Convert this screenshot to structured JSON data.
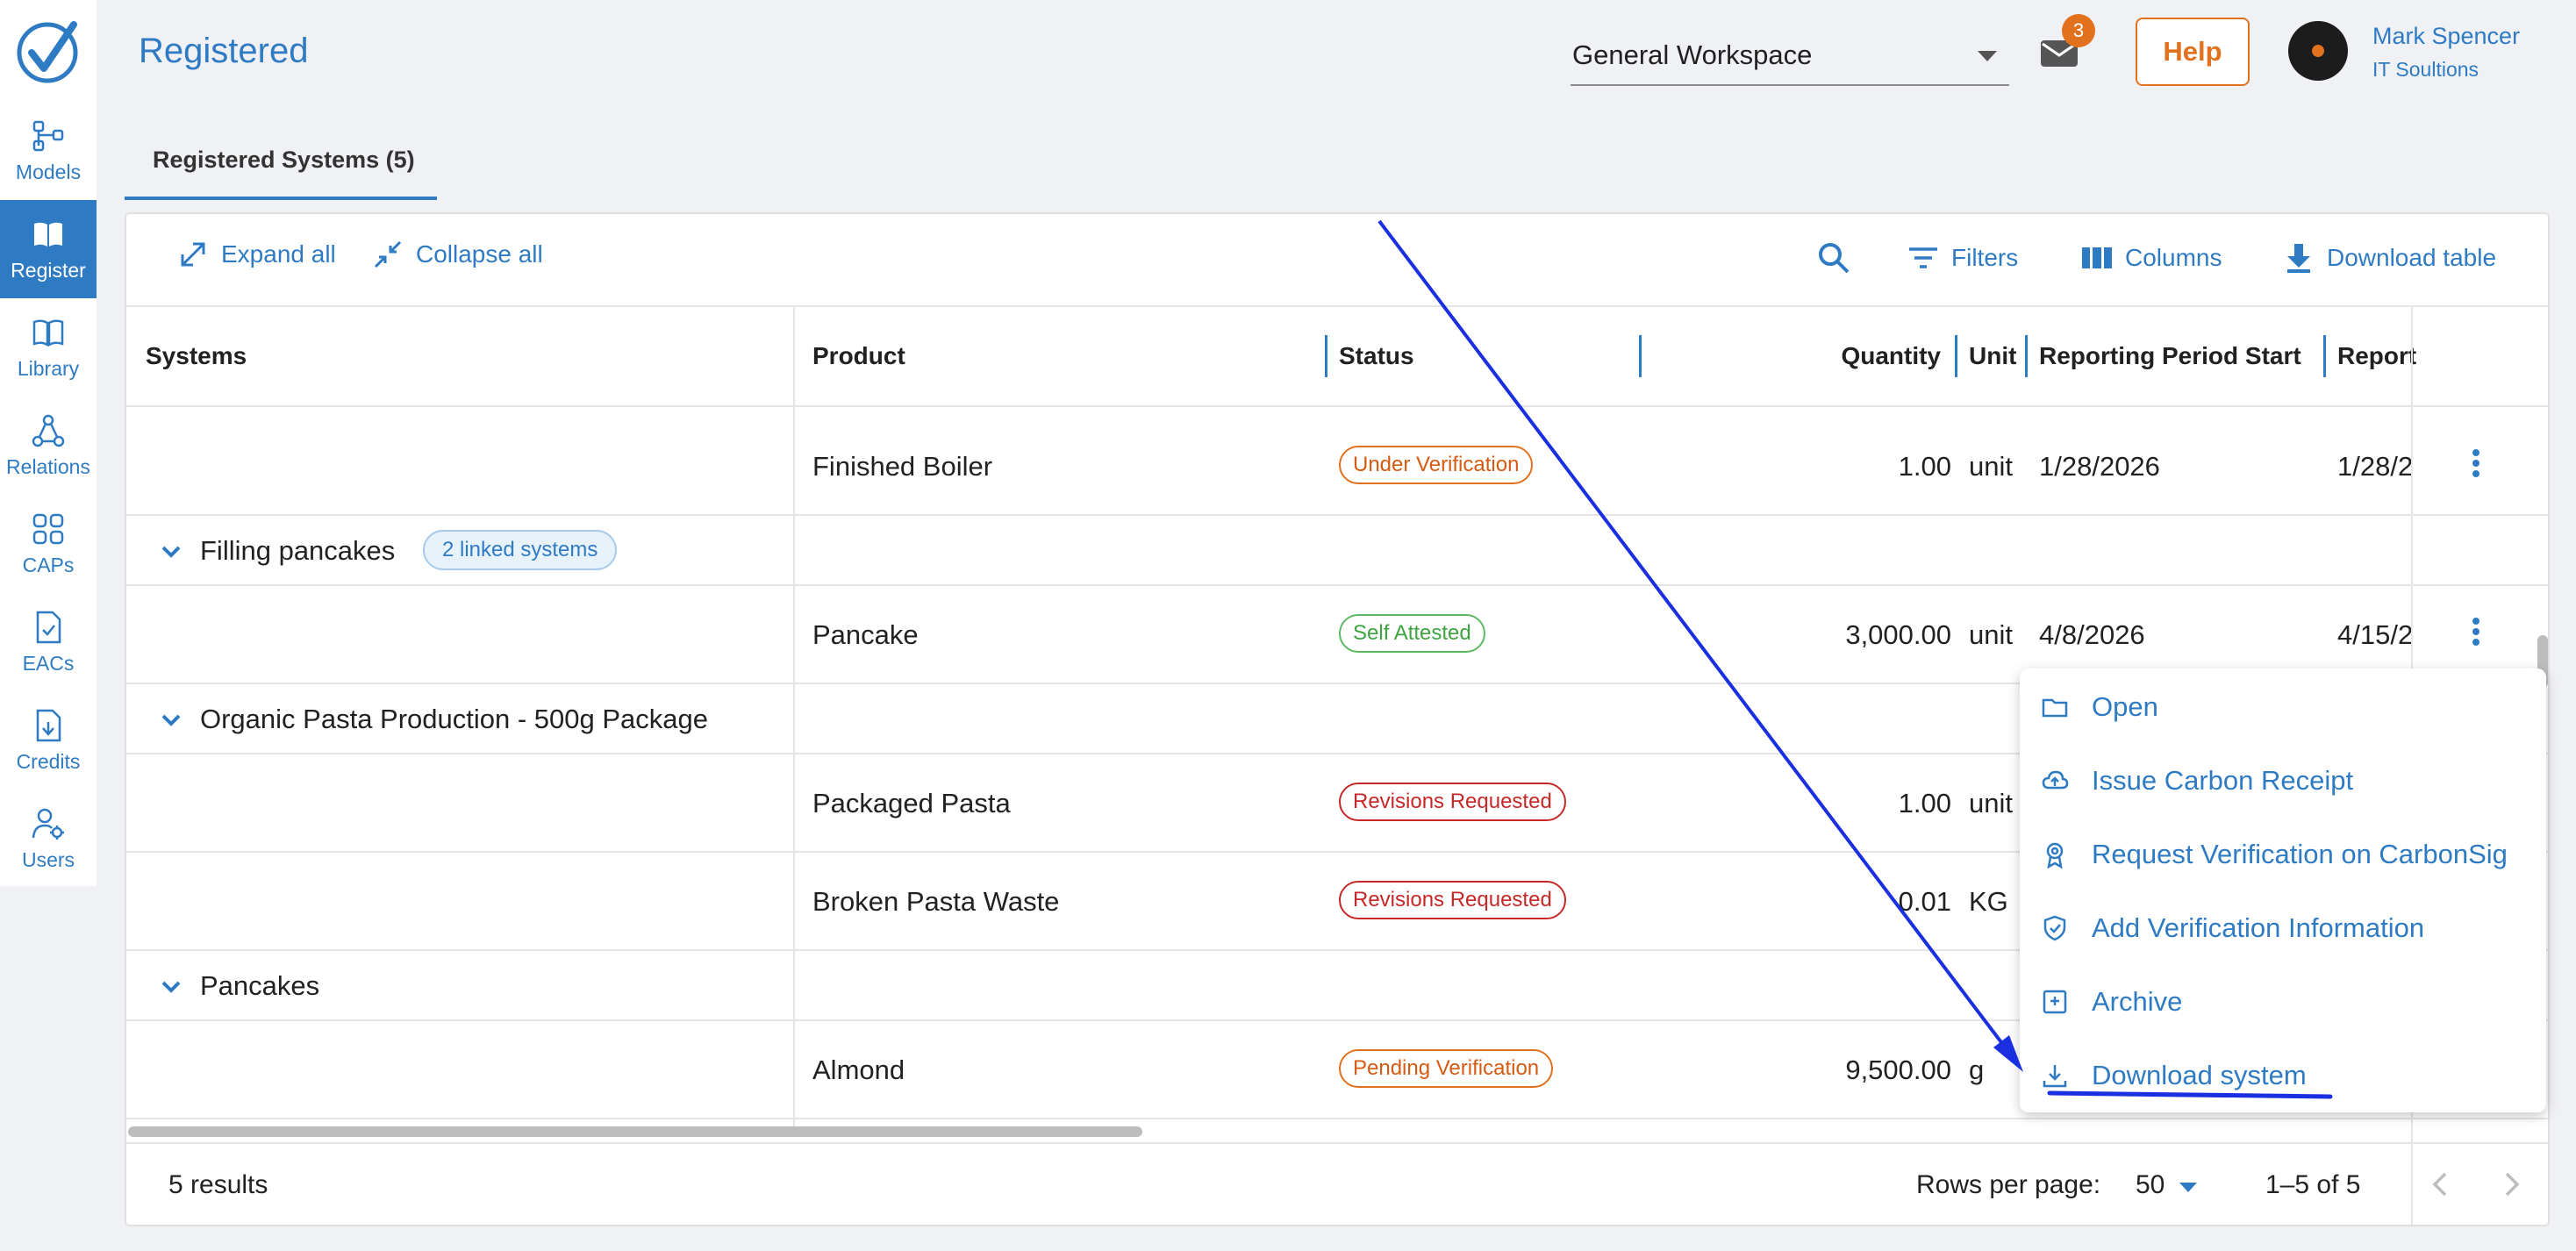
{
  "nav": {
    "items": [
      {
        "label": "Models",
        "icon": "models-icon"
      },
      {
        "label": "Register",
        "icon": "book-icon",
        "active": true
      },
      {
        "label": "Library",
        "icon": "library-icon"
      },
      {
        "label": "Relations",
        "icon": "relations-icon"
      },
      {
        "label": "CAPs",
        "icon": "caps-icon"
      },
      {
        "label": "EACs",
        "icon": "eacs-icon"
      },
      {
        "label": "Credits",
        "icon": "credits-icon"
      },
      {
        "label": "Users",
        "icon": "users-icon"
      }
    ]
  },
  "header": {
    "title": "Registered",
    "workspace": "General Workspace",
    "mail_count": "3",
    "help_label": "Help",
    "user_name": "Mark Spencer",
    "user_org": "IT Soultions"
  },
  "tabs": [
    {
      "label": "Registered Systems (5)"
    }
  ],
  "toolbar": {
    "expand_all": "Expand all",
    "collapse_all": "Collapse all",
    "filters": "Filters",
    "columns": "Columns",
    "download_table": "Download table"
  },
  "table": {
    "headers": {
      "systems": "Systems",
      "product": "Product",
      "status": "Status",
      "quantity": "Quantity",
      "unit": "Unit",
      "reporting_start": "Reporting Period Start",
      "reporting_end": "Report"
    },
    "rows": [
      {
        "product": "Finished Boiler",
        "status": "Under Verification",
        "quantity": "1.00",
        "unit": "unit",
        "start": "1/28/2026",
        "end": "1/28/2"
      },
      {
        "group": "Filling pancakes",
        "linked": "2 linked systems"
      },
      {
        "product": "Pancake",
        "status": "Self Attested",
        "quantity": "3,000.00",
        "unit": "unit",
        "start": "4/8/2026",
        "end": "4/15/2"
      },
      {
        "group": "Organic Pasta Production - 500g Package"
      },
      {
        "product": "Packaged Pasta",
        "status": "Revisions Requested",
        "quantity": "1.00",
        "unit": "unit"
      },
      {
        "product": "Broken Pasta Waste",
        "status": "Revisions Requested",
        "quantity": "0.01",
        "unit": "KG"
      },
      {
        "group": "Pancakes"
      },
      {
        "product": "Almond",
        "status": "Pending Verification",
        "quantity": "9,500.00",
        "unit": "g"
      }
    ]
  },
  "menu": {
    "items": [
      {
        "label": "Open",
        "icon": "folder-icon"
      },
      {
        "label": "Issue Carbon Receipt",
        "icon": "cloud-upload-icon"
      },
      {
        "label": "Request Verification on CarbonSig",
        "icon": "award-icon"
      },
      {
        "label": "Add Verification Information",
        "icon": "shield-check-icon"
      },
      {
        "label": "Archive",
        "icon": "archive-icon"
      },
      {
        "label": "Download system",
        "icon": "download-icon"
      }
    ]
  },
  "footer": {
    "results": "5 results",
    "rows_per_page_label": "Rows per page:",
    "rows_per_page": "50",
    "page_range": "1–5 of 5"
  },
  "colors": {
    "accent": "#2e7bc4",
    "orange": "#e2711d",
    "green": "#3da441",
    "red": "#c62828",
    "annotation": "#1a2fe0"
  }
}
